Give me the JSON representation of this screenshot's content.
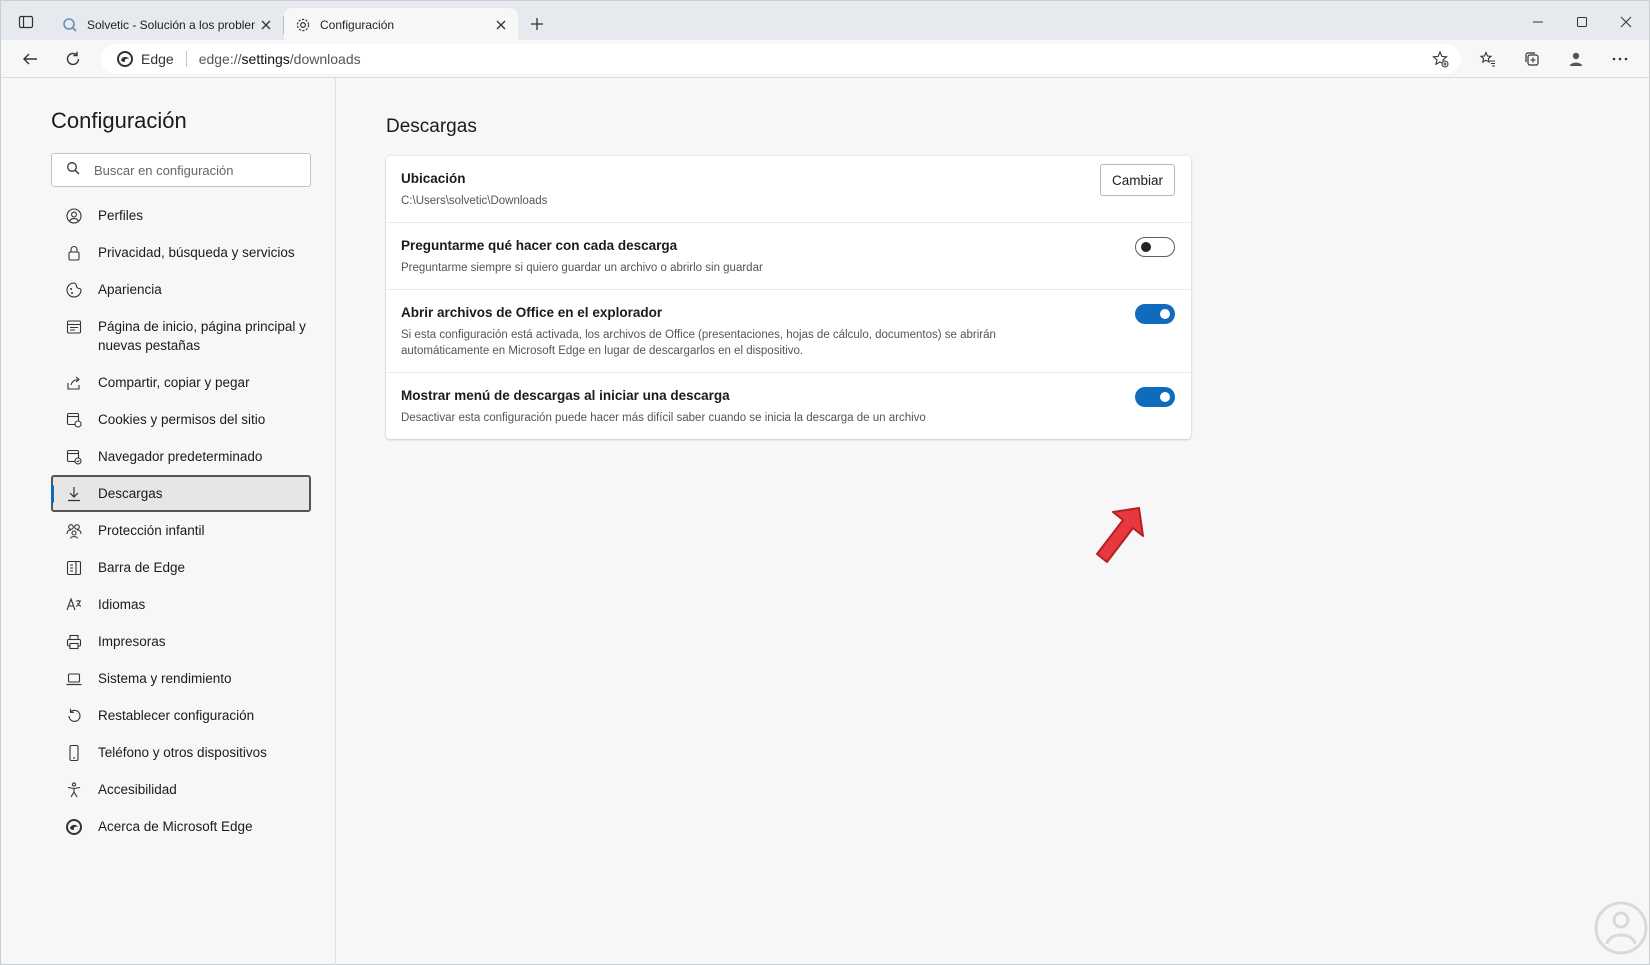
{
  "tabs": [
    {
      "title": "Solvetic - Solución a los problem",
      "active": false
    },
    {
      "title": "Configuración",
      "active": true
    }
  ],
  "addressbar": {
    "site_label": "Edge",
    "url_prefix": "edge://",
    "url_path": "settings",
    "url_suffix": "/downloads"
  },
  "sidebar": {
    "title": "Configuración",
    "search_placeholder": "Buscar en configuración",
    "items": [
      {
        "label": "Perfiles",
        "icon": "profile-icon"
      },
      {
        "label": "Privacidad, búsqueda y servicios",
        "icon": "lock-icon"
      },
      {
        "label": "Apariencia",
        "icon": "appearance-icon"
      },
      {
        "label": "Página de inicio, página principal y nuevas pestañas",
        "icon": "home-page-icon"
      },
      {
        "label": "Compartir, copiar y pegar",
        "icon": "share-icon"
      },
      {
        "label": "Cookies y permisos del sitio",
        "icon": "cookies-icon"
      },
      {
        "label": "Navegador predeterminado",
        "icon": "default-browser-icon"
      },
      {
        "label": "Descargas",
        "icon": "download-icon",
        "active": true
      },
      {
        "label": "Protección infantil",
        "icon": "family-icon"
      },
      {
        "label": "Barra de Edge",
        "icon": "edge-bar-icon"
      },
      {
        "label": "Idiomas",
        "icon": "languages-icon"
      },
      {
        "label": "Impresoras",
        "icon": "printer-icon"
      },
      {
        "label": "Sistema y rendimiento",
        "icon": "laptop-icon"
      },
      {
        "label": "Restablecer configuración",
        "icon": "reset-icon"
      },
      {
        "label": "Teléfono y otros dispositivos",
        "icon": "phone-icon"
      },
      {
        "label": "Accesibilidad",
        "icon": "accessibility-icon"
      },
      {
        "label": "Acerca de Microsoft Edge",
        "icon": "edge-logo-icon"
      }
    ]
  },
  "main": {
    "title": "Descargas",
    "location": {
      "label": "Ubicación",
      "path": "C:\\Users\\solvetic\\Downloads",
      "button": "Cambiar"
    },
    "settings": [
      {
        "label": "Preguntarme qué hacer con cada descarga",
        "desc": "Preguntarme siempre si quiero guardar un archivo o abrirlo sin guardar",
        "enabled": false
      },
      {
        "label": "Abrir archivos de Office en el explorador",
        "desc": "Si esta configuración está activada, los archivos de Office (presentaciones, hojas de cálculo, documentos) se abrirán automáticamente en Microsoft Edge en lugar de descargarlos en el dispositivo.",
        "enabled": true
      },
      {
        "label": "Mostrar menú de descargas al iniciar una descarga",
        "desc": "Desactivar esta configuración puede hacer más difícil saber cuando se inicia la descarga de un archivo",
        "enabled": true
      }
    ]
  },
  "colors": {
    "accent": "#0f6cbd",
    "annotation_arrow": "#e8383d"
  }
}
